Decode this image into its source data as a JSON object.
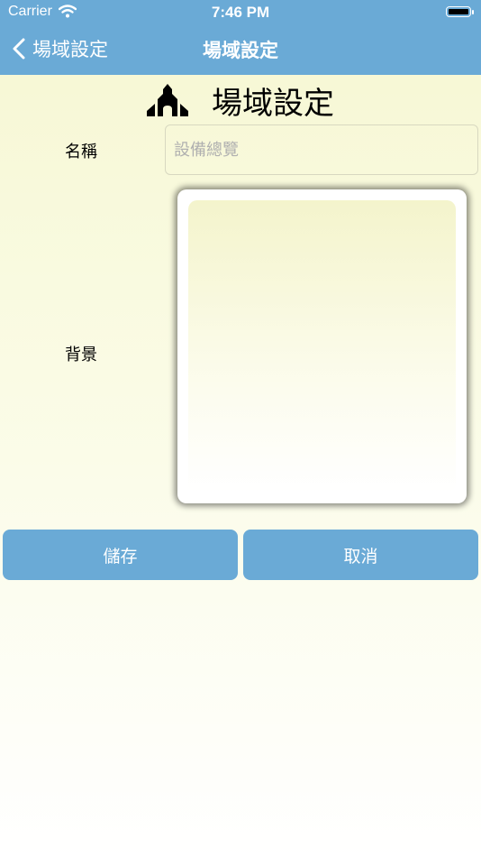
{
  "status_bar": {
    "carrier": "Carrier",
    "time": "7:46 PM"
  },
  "nav": {
    "back_label": "場域設定",
    "title": "場域設定"
  },
  "header": {
    "title": "場域設定",
    "icon": "church-icon"
  },
  "form": {
    "name_label": "名稱",
    "name_value": "",
    "name_placeholder": "設備總覽",
    "background_label": "背景"
  },
  "buttons": {
    "save": "儲存",
    "cancel": "取消"
  },
  "colors": {
    "accent": "#6aaad6",
    "background_top": "#f6f7d2",
    "background_bottom": "#ffffff"
  }
}
